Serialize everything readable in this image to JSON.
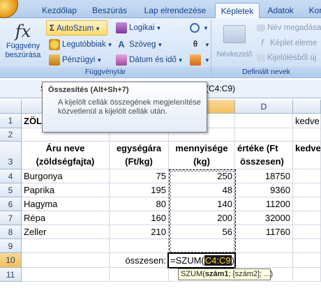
{
  "tabs": [
    "Kezdőlap",
    "Beszúrás",
    "Lap elrendezése",
    "Képletek",
    "Adatok",
    "Kor"
  ],
  "ribbon": {
    "function_insert": "Függvény\nbeszúrása",
    "function_insert_l1": "Függvény",
    "function_insert_l2": "beszúrása",
    "autosum": "AutoSzum",
    "recent": "Legutóbbiak",
    "financial": "Pénzügyi",
    "logical": "Logikai",
    "text": "Szöveg",
    "datetime": "Dátum és idő",
    "group_library": "Függvénytár",
    "name_manager": "Névkezelő",
    "define_name": "Név megadása",
    "use_in_formula": "Képlet eleme",
    "create_from_selection": "Kijelölésből új",
    "group_names": "Definiált nevek",
    "icon_fx": "fx-icon",
    "icon_autosum": "sigma-icon"
  },
  "formula_bar": {
    "name_box": "S",
    "formula_fragment": "(C4:C9)"
  },
  "tooltip": {
    "title": "Összesítés (Alt+Sh+7)",
    "body": "A kijelölt cellák összegének megjelenítése közvetlenül a kijelölt cellák után."
  },
  "columns": [
    "A",
    "B",
    "C",
    "D"
  ],
  "rows": [
    "1",
    "2",
    "3",
    "4",
    "5",
    "6",
    "7",
    "8",
    "9",
    "10",
    "11"
  ],
  "sheet": {
    "a1": "ZÖLDS",
    "e1": "kedve",
    "headers": {
      "a_l1": "Áru neve",
      "a_l2": "(zöldségfajta)",
      "b_l1": "egységára",
      "b_l2": "(Ft/kg)",
      "c_l1": "mennyisége",
      "c_l2": "(kg)",
      "d_l1": "értéke (Ft",
      "d_l2": "összesen)",
      "e": "kedve"
    },
    "data_rows": [
      {
        "name": "Burgonya",
        "price": "75",
        "qty": "250",
        "value": "18750"
      },
      {
        "name": "Paprika",
        "price": "195",
        "qty": "48",
        "value": "9360"
      },
      {
        "name": "Hagyma",
        "price": "80",
        "qty": "140",
        "value": "11200"
      },
      {
        "name": "Répa",
        "price": "160",
        "prefix_dummy": "",
        "qty": "200",
        "value": "32000"
      },
      {
        "name": "Zeller",
        "price": "210",
        "qty": "56",
        "value": "11760"
      }
    ],
    "total_label": "összesen:",
    "formula_prefix": "=SZUM(",
    "formula_range": "C4:C9",
    "formula_suffix": ")",
    "hint_fn": "SZUM(",
    "hint_arg1": "szám1",
    "hint_rest": "; [szám2]; ...)"
  },
  "colors": {
    "accent": "#15428b",
    "selection_range": "#e8b800"
  }
}
